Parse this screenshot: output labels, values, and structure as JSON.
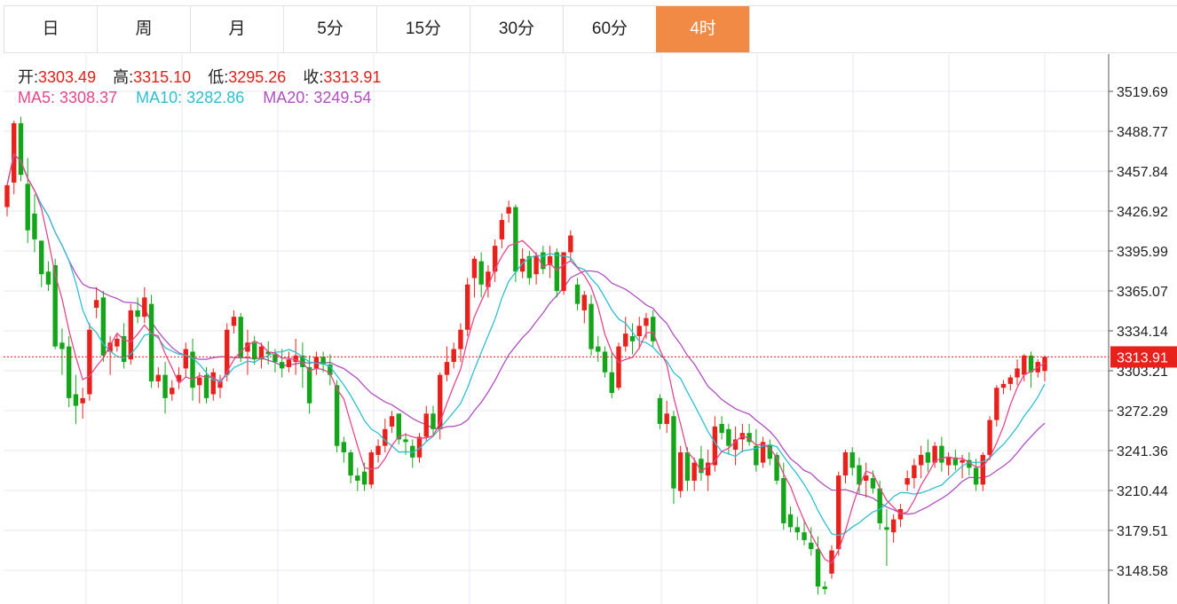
{
  "tabs": [
    {
      "label": "日",
      "active": false
    },
    {
      "label": "周",
      "active": false
    },
    {
      "label": "月",
      "active": false
    },
    {
      "label": "5分",
      "active": false
    },
    {
      "label": "15分",
      "active": false
    },
    {
      "label": "30分",
      "active": false
    },
    {
      "label": "60分",
      "active": false
    },
    {
      "label": "4时",
      "active": true
    }
  ],
  "ohlc_info": {
    "open_label": "开:",
    "open": "3303.49",
    "high_label": "高:",
    "high": "3315.10",
    "low_label": "低:",
    "low": "3295.26",
    "close_label": "收:",
    "close": "3313.91"
  },
  "ma_info": {
    "ma5_label": "MA5:",
    "ma5": "3308.37",
    "ma10_label": "MA10:",
    "ma10": "3282.86",
    "ma20_label": "MA20:",
    "ma20": "3249.54"
  },
  "colors": {
    "up": "#e8211c",
    "down": "#14a51b",
    "ma5": "#e4478a",
    "ma10": "#2fbfcf",
    "ma20": "#b04fc0",
    "grid": "#e6e9ef",
    "active_tab": "#f08a45",
    "current_price": "#e8211c"
  },
  "chart_data": {
    "type": "candlestick",
    "y_ticks": [
      "3519.69",
      "3488.77",
      "3457.84",
      "3426.92",
      "3395.99",
      "3365.07",
      "3334.14",
      "3303.21",
      "3272.29",
      "3241.36",
      "3210.44",
      "3179.51",
      "3148.58"
    ],
    "ylim": [
      3133,
      3545
    ],
    "current_price": "3313.91",
    "candles": [
      [
        3430,
        3448,
        3423,
        3447
      ],
      [
        3449,
        3497,
        3440,
        3495
      ],
      [
        3495,
        3500,
        3450,
        3455
      ],
      [
        3448,
        3468,
        3402,
        3412
      ],
      [
        3425,
        3440,
        3395,
        3405
      ],
      [
        3404,
        3398,
        3368,
        3378
      ],
      [
        3380,
        3388,
        3365,
        3370
      ],
      [
        3385,
        3390,
        3320,
        3322
      ],
      [
        3325,
        3336,
        3300,
        3320
      ],
      [
        3322,
        3330,
        3275,
        3282
      ],
      [
        3285,
        3300,
        3262,
        3276
      ],
      [
        3278,
        3290,
        3266,
        3282
      ],
      [
        3285,
        3340,
        3280,
        3335
      ],
      [
        3352,
        3368,
        3344,
        3358
      ],
      [
        3360,
        3365,
        3310,
        3315
      ],
      [
        3318,
        3330,
        3300,
        3325
      ],
      [
        3322,
        3332,
        3318,
        3328
      ],
      [
        3330,
        3340,
        3305,
        3310
      ],
      [
        3312,
        3355,
        3308,
        3350
      ],
      [
        3350,
        3360,
        3340,
        3345
      ],
      [
        3345,
        3368,
        3340,
        3360
      ],
      [
        3355,
        3362,
        3290,
        3295
      ],
      [
        3295,
        3306,
        3290,
        3300
      ],
      [
        3300,
        3310,
        3270,
        3282
      ],
      [
        3285,
        3296,
        3280,
        3290
      ],
      [
        3295,
        3306,
        3289,
        3300
      ],
      [
        3305,
        3325,
        3298,
        3320
      ],
      [
        3318,
        3328,
        3280,
        3290
      ],
      [
        3292,
        3302,
        3278,
        3298
      ],
      [
        3300,
        3306,
        3278,
        3282
      ],
      [
        3285,
        3305,
        3280,
        3302
      ],
      [
        3290,
        3300,
        3282,
        3295
      ],
      [
        3300,
        3340,
        3295,
        3335
      ],
      [
        3338,
        3350,
        3332,
        3345
      ],
      [
        3345,
        3348,
        3310,
        3314
      ],
      [
        3318,
        3335,
        3300,
        3325
      ],
      [
        3325,
        3330,
        3308,
        3312
      ],
      [
        3312,
        3325,
        3305,
        3322
      ],
      [
        3318,
        3326,
        3308,
        3316
      ],
      [
        3316,
        3320,
        3302,
        3310
      ],
      [
        3310,
        3320,
        3298,
        3305
      ],
      [
        3306,
        3318,
        3302,
        3312
      ],
      [
        3310,
        3328,
        3300,
        3315
      ],
      [
        3315,
        3325,
        3290,
        3306
      ],
      [
        3306,
        3315,
        3270,
        3278
      ],
      [
        3305,
        3318,
        3300,
        3314
      ],
      [
        3314,
        3318,
        3302,
        3308
      ],
      [
        3308,
        3316,
        3292,
        3300
      ],
      [
        3292,
        3296,
        3240,
        3245
      ],
      [
        3248,
        3252,
        3232,
        3240
      ],
      [
        3240,
        3242,
        3216,
        3222
      ],
      [
        3222,
        3228,
        3210,
        3218
      ],
      [
        3225,
        3232,
        3210,
        3215
      ],
      [
        3215,
        3242,
        3212,
        3240
      ],
      [
        3238,
        3250,
        3232,
        3245
      ],
      [
        3245,
        3266,
        3240,
        3258
      ],
      [
        3260,
        3272,
        3255,
        3268
      ],
      [
        3270,
        3270,
        3246,
        3250
      ],
      [
        3250,
        3255,
        3238,
        3248
      ],
      [
        3245,
        3250,
        3228,
        3236
      ],
      [
        3236,
        3255,
        3232,
        3252
      ],
      [
        3252,
        3276,
        3248,
        3270
      ],
      [
        3270,
        3276,
        3252,
        3258
      ],
      [
        3258,
        3302,
        3250,
        3300
      ],
      [
        3300,
        3322,
        3295,
        3310
      ],
      [
        3310,
        3325,
        3305,
        3320
      ],
      [
        3320,
        3340,
        3310,
        3335
      ],
      [
        3335,
        3375,
        3330,
        3370
      ],
      [
        3375,
        3392,
        3360,
        3390
      ],
      [
        3388,
        3395,
        3360,
        3370
      ],
      [
        3368,
        3385,
        3360,
        3380
      ],
      [
        3380,
        3405,
        3372,
        3400
      ],
      [
        3405,
        3425,
        3398,
        3420
      ],
      [
        3425,
        3435,
        3418,
        3430
      ],
      [
        3430,
        3432,
        3372,
        3380
      ],
      [
        3380,
        3398,
        3375,
        3390
      ],
      [
        3392,
        3396,
        3370,
        3375
      ],
      [
        3378,
        3395,
        3370,
        3392
      ],
      [
        3395,
        3400,
        3378,
        3382
      ],
      [
        3385,
        3400,
        3375,
        3392
      ],
      [
        3395,
        3398,
        3360,
        3365
      ],
      [
        3365,
        3395,
        3362,
        3395
      ],
      [
        3395,
        3412,
        3388,
        3408
      ],
      [
        3370,
        3375,
        3350,
        3355
      ],
      [
        3350,
        3365,
        3340,
        3362
      ],
      [
        3355,
        3362,
        3315,
        3320
      ],
      [
        3322,
        3330,
        3310,
        3318
      ],
      [
        3318,
        3322,
        3298,
        3302
      ],
      [
        3302,
        3318,
        3282,
        3286
      ],
      [
        3290,
        3325,
        3288,
        3322
      ],
      [
        3322,
        3345,
        3318,
        3332
      ],
      [
        3330,
        3340,
        3316,
        3326
      ],
      [
        3330,
        3345,
        3320,
        3338
      ],
      [
        3338,
        3348,
        3328,
        3344
      ],
      [
        3345,
        3350,
        3322,
        3326
      ],
      [
        3282,
        3285,
        3258,
        3262
      ],
      [
        3262,
        3280,
        3255,
        3270
      ],
      [
        3268,
        3272,
        3200,
        3212
      ],
      [
        3210,
        3245,
        3205,
        3240
      ],
      [
        3240,
        3244,
        3210,
        3218
      ],
      [
        3218,
        3236,
        3210,
        3232
      ],
      [
        3235,
        3245,
        3218,
        3224
      ],
      [
        3222,
        3242,
        3210,
        3232
      ],
      [
        3230,
        3268,
        3225,
        3260
      ],
      [
        3262,
        3268,
        3250,
        3255
      ],
      [
        3258,
        3262,
        3238,
        3245
      ],
      [
        3242,
        3260,
        3230,
        3250
      ],
      [
        3250,
        3262,
        3240,
        3255
      ],
      [
        3255,
        3262,
        3245,
        3248
      ],
      [
        3245,
        3258,
        3225,
        3230
      ],
      [
        3232,
        3252,
        3228,
        3248
      ],
      [
        3246,
        3250,
        3230,
        3235
      ],
      [
        3238,
        3240,
        3215,
        3218
      ],
      [
        3220,
        3232,
        3180,
        3185
      ],
      [
        3192,
        3198,
        3178,
        3182
      ],
      [
        3182,
        3190,
        3172,
        3178
      ],
      [
        3178,
        3188,
        3168,
        3172
      ],
      [
        3170,
        3182,
        3160,
        3165
      ],
      [
        3165,
        3175,
        3130,
        3136
      ],
      [
        3136,
        3140,
        3130,
        3134
      ],
      [
        3146,
        3168,
        3142,
        3164
      ],
      [
        3165,
        3225,
        3160,
        3222
      ],
      [
        3222,
        3242,
        3216,
        3240
      ],
      [
        3240,
        3244,
        3222,
        3228
      ],
      [
        3230,
        3236,
        3208,
        3215
      ],
      [
        3218,
        3232,
        3205,
        3222
      ],
      [
        3220,
        3226,
        3208,
        3212
      ],
      [
        3212,
        3218,
        3180,
        3185
      ],
      [
        3182,
        3196,
        3152,
        3180
      ],
      [
        3178,
        3192,
        3170,
        3188
      ],
      [
        3188,
        3200,
        3182,
        3196
      ],
      [
        3215,
        3226,
        3210,
        3220
      ],
      [
        3220,
        3235,
        3212,
        3230
      ],
      [
        3230,
        3245,
        3220,
        3238
      ],
      [
        3240,
        3250,
        3225,
        3232
      ],
      [
        3232,
        3248,
        3228,
        3245
      ],
      [
        3245,
        3252,
        3225,
        3232
      ],
      [
        3230,
        3240,
        3222,
        3236
      ],
      [
        3236,
        3242,
        3226,
        3230
      ],
      [
        3232,
        3238,
        3220,
        3234
      ],
      [
        3234,
        3240,
        3222,
        3228
      ],
      [
        3228,
        3235,
        3210,
        3215
      ],
      [
        3215,
        3240,
        3210,
        3238
      ],
      [
        3238,
        3268,
        3234,
        3265
      ],
      [
        3265,
        3292,
        3260,
        3290
      ],
      [
        3290,
        3296,
        3285,
        3293
      ],
      [
        3293,
        3300,
        3288,
        3298
      ],
      [
        3298,
        3312,
        3292,
        3305
      ],
      [
        3300,
        3316,
        3295,
        3315
      ],
      [
        3315,
        3318,
        3290,
        3302
      ],
      [
        3302,
        3312,
        3298,
        3310
      ],
      [
        3303,
        3315,
        3295,
        3314
      ]
    ]
  }
}
